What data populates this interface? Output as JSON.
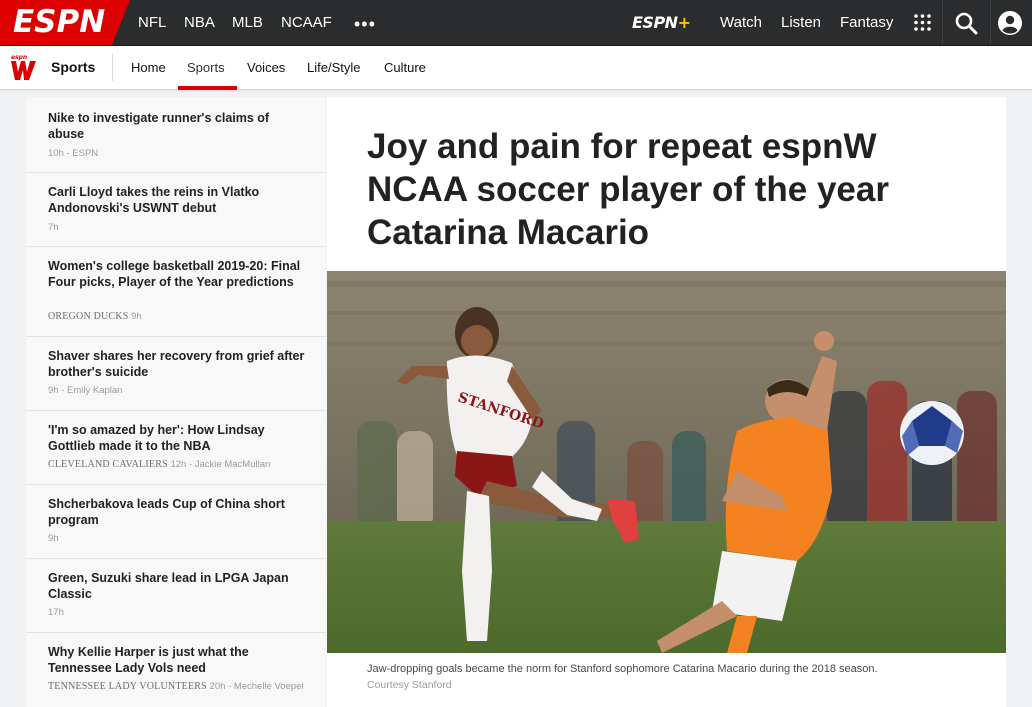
{
  "topnav": {
    "logo": "ESPN",
    "items": [
      "NFL",
      "NBA",
      "MLB",
      "NCAAF"
    ],
    "more": "•••",
    "espnplus": "ESPN",
    "espnplus_plus": "+",
    "right_items": [
      "Watch",
      "Listen",
      "Fantasy"
    ],
    "icons": [
      "grid-icon",
      "search-icon",
      "profile-icon"
    ]
  },
  "subnav": {
    "brand": "Sports",
    "items": [
      "Home",
      "Sports",
      "Voices",
      "Life/Style",
      "Culture"
    ],
    "active": "Sports"
  },
  "headlines": [
    {
      "title": "Nike to investigate runner's claims of abuse",
      "team": "",
      "meta": "10h - ESPN"
    },
    {
      "title": "Carli Lloyd takes the reins in Vlatko Andonovski's USWNT debut",
      "team": "",
      "meta": "7h"
    },
    {
      "title": "Women's college basketball 2019-20: Final Four picks, Player of the Year predictions",
      "team": "OREGON DUCKS",
      "meta": "9h"
    },
    {
      "title": "Shaver shares her recovery from grief after brother's suicide",
      "team": "",
      "meta": "9h - Emily Kaplan"
    },
    {
      "title": "'I'm so amazed by her': How Lindsay Gottlieb made it to the NBA",
      "team": "CLEVELAND CAVALIERS",
      "meta": "12h - Jackie MacMullan"
    },
    {
      "title": "Shcherbakova leads Cup of China short program",
      "team": "",
      "meta": "9h"
    },
    {
      "title": "Green, Suzuki share lead in LPGA Japan Classic",
      "team": "",
      "meta": "17h"
    },
    {
      "title": "Why Kellie Harper is just what the Tennessee Lady Vols need",
      "team": "TENNESSEE LADY VOLUNTEERS",
      "meta": "20h - Mechelle Voepel"
    }
  ],
  "article": {
    "headline": "Joy and pain for repeat espnW NCAA soccer player of the year Catarina Macario",
    "caption": "Jaw-dropping goals became the norm for Stanford sophomore Catarina Macario during the 2018 season.",
    "credit": "Courtesy Stanford",
    "jersey_text": "STANFORD"
  },
  "colors": {
    "espn_red": "#dd0000",
    "nav_bg": "#2b2c2d",
    "stanford_cardinal": "#8c1515",
    "tennessee_orange": "#f58220"
  }
}
